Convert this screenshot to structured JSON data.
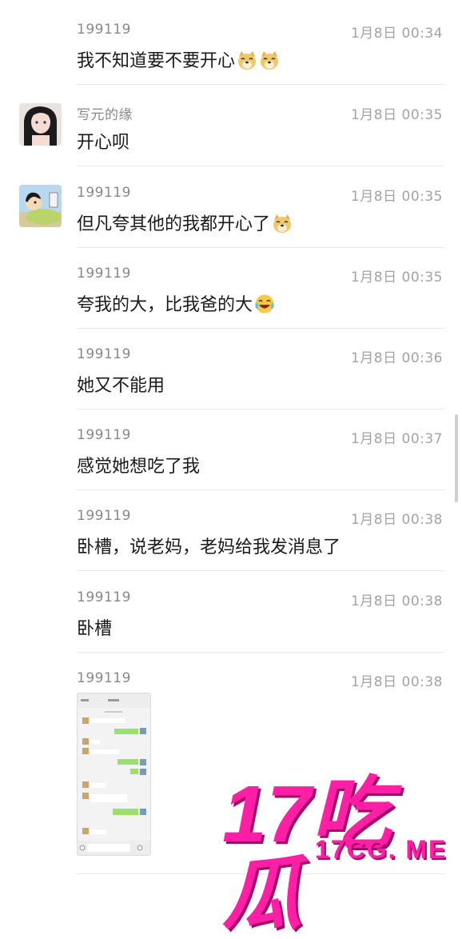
{
  "messages": [
    {
      "sender": "199119",
      "time": "1月8日 00:34",
      "text": "我不知道要不要开心",
      "emoji": [
        "doge-icon",
        "doge-icon"
      ],
      "avatar": null
    },
    {
      "sender": "写元的缘",
      "time": "1月8日 00:35",
      "text": "开心呗",
      "emoji": [],
      "avatar": "girl-avatar"
    },
    {
      "sender": "199119",
      "time": "1月8日 00:35",
      "text": "但凡夸其他的我都开心了",
      "emoji": [
        "doge-icon"
      ],
      "avatar": "cartoon-avatar"
    },
    {
      "sender": "199119",
      "time": "1月8日 00:35",
      "text": "夸我的大，比我爸的大",
      "emoji": [
        "laugh-cry-icon"
      ],
      "avatar": null
    },
    {
      "sender": "199119",
      "time": "1月8日 00:36",
      "text": "她又不能用",
      "emoji": [],
      "avatar": null
    },
    {
      "sender": "199119",
      "time": "1月8日 00:37",
      "text": "感觉她想吃了我",
      "emoji": [],
      "avatar": null
    },
    {
      "sender": "199119",
      "time": "1月8日 00:38",
      "text": "卧槽，说老妈，老妈给我发消息了",
      "emoji": [],
      "avatar": null
    },
    {
      "sender": "199119",
      "time": "1月8日 00:38",
      "text": "卧槽",
      "emoji": [],
      "avatar": null
    },
    {
      "sender": "199119",
      "time": "1月8日 00:38",
      "text": "",
      "emoji": [],
      "avatar": null,
      "image": "chat-screenshot-thumbnail"
    }
  ],
  "watermark": {
    "big": "17吃瓜",
    "small": "17CG. ME"
  },
  "colors": {
    "watermark": "#ff1fa7",
    "text": "#1a1a1a",
    "meta": "#999999"
  }
}
